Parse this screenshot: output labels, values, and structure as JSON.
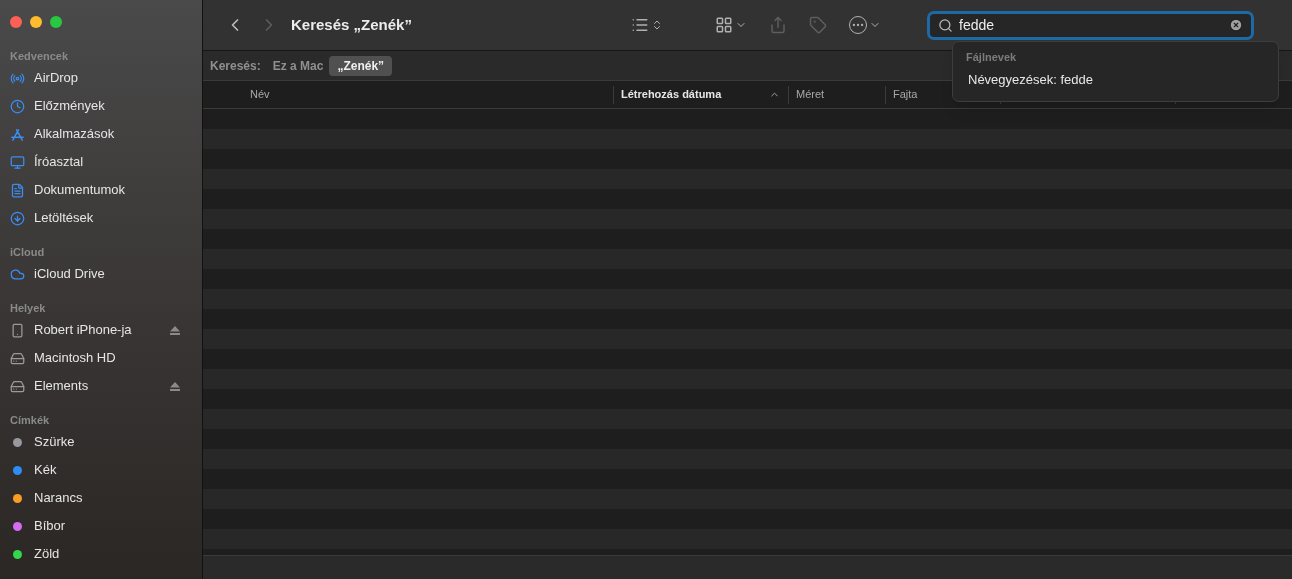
{
  "window": {
    "title": "Keresés „Zenék”"
  },
  "navigation": {
    "back_disabled": false,
    "forward_disabled": true
  },
  "toolbar": {
    "share_disabled": true,
    "tag_disabled": true
  },
  "sidebar": {
    "sections": [
      {
        "heading": "Kedvencek",
        "items": [
          {
            "kind": "airdrop",
            "label": "AirDrop",
            "ejectable": false
          },
          {
            "kind": "recents",
            "label": "Előzmények",
            "ejectable": false
          },
          {
            "kind": "apps",
            "label": "Alkalmazások",
            "ejectable": false
          },
          {
            "kind": "desktop",
            "label": "Íróasztal",
            "ejectable": false
          },
          {
            "kind": "document",
            "label": "Dokumentumok",
            "ejectable": false
          },
          {
            "kind": "download",
            "label": "Letöltések",
            "ejectable": false
          }
        ]
      },
      {
        "heading": "iCloud",
        "items": [
          {
            "kind": "cloud",
            "label": "iCloud Drive",
            "ejectable": false
          }
        ]
      },
      {
        "heading": "Helyek",
        "items": [
          {
            "kind": "phone",
            "label": "Robert iPhone-ja",
            "ejectable": true
          },
          {
            "kind": "drive",
            "label": "Macintosh HD",
            "ejectable": false
          },
          {
            "kind": "drive",
            "label": "Elements",
            "ejectable": true
          }
        ]
      },
      {
        "heading": "Címkék",
        "items": [
          {
            "kind": "tag",
            "label": "Szürke",
            "color": "#98989d",
            "ejectable": false
          },
          {
            "kind": "tag",
            "label": "Kék",
            "color": "#2f8cf7",
            "ejectable": false
          },
          {
            "kind": "tag",
            "label": "Narancs",
            "color": "#fb9d25",
            "ejectable": false
          },
          {
            "kind": "tag",
            "label": "Bíbor",
            "color": "#d56cf2",
            "ejectable": false
          },
          {
            "kind": "tag",
            "label": "Zöld",
            "color": "#32d74b",
            "ejectable": false
          }
        ]
      }
    ]
  },
  "search": {
    "value": "fedde",
    "focused": true,
    "suggestions": {
      "heading": "Fájlnevek",
      "items": [
        "Névegyezések: fedde"
      ]
    }
  },
  "scope_bar": {
    "label": "Keresés:",
    "options": [
      {
        "label": "Ez a Mac",
        "selected": false
      },
      {
        "label": "„Zenék”",
        "selected": true
      }
    ]
  },
  "table": {
    "columns": [
      {
        "label": "Név",
        "sorted": false
      },
      {
        "label": "Létrehozás dátuma",
        "sorted": true
      },
      {
        "label": "Méret",
        "sorted": false
      },
      {
        "label": "Fajta",
        "sorted": false
      }
    ]
  }
}
